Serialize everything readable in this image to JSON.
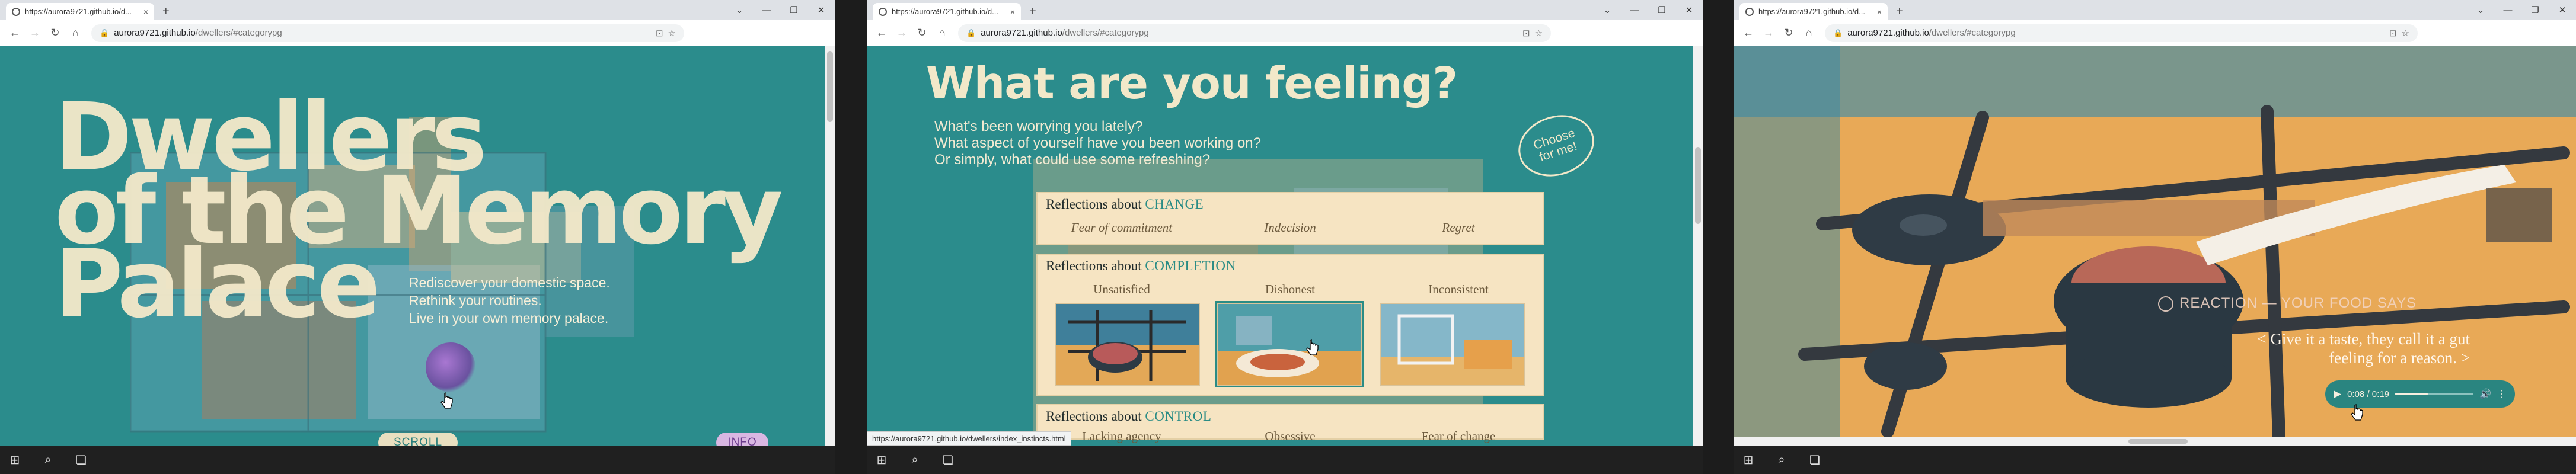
{
  "colors": {
    "teal": "#2b8c8c",
    "cream": "#f2e8c9",
    "lavender": "#d9b7e2",
    "accent_keyword": "#2a8c85"
  },
  "screens": [
    {
      "tab": {
        "title": "https://aurora9721.github.io/d...",
        "close": "×"
      },
      "new_tab": "+",
      "window_controls": {
        "tabs_menu": "⌄",
        "minimize": "—",
        "restore": "❐",
        "close": "✕"
      },
      "address": {
        "host": "aurora9721.github.io",
        "path": "/dwellers/#categorypg"
      },
      "hero": {
        "line1": "Dwellers",
        "line2": "of the Memory",
        "line3": "Palace"
      },
      "tagline": {
        "line1": "Rediscover your domestic space.",
        "line2": "Rethink your routines.",
        "line3": "Live in your own memory palace."
      },
      "scroll_label": "SCROLL",
      "info_label": "INFO"
    },
    {
      "tab": {
        "title": "https://aurora9721.github.io/d...",
        "close": "×"
      },
      "new_tab": "+",
      "window_controls": {
        "tabs_menu": "⌄",
        "minimize": "—",
        "restore": "❐",
        "close": "✕"
      },
      "address": {
        "host": "aurora9721.github.io",
        "path": "/dwellers/#categorypg"
      },
      "heading": "What are you feeling?",
      "questions": {
        "q1": "What's been worrying you lately?",
        "q2": "What aspect of yourself have you been working on?",
        "q3": "Or simply, what could use some refreshing?"
      },
      "stamp": {
        "line1": "Choose",
        "line2": "for me!"
      },
      "categories": [
        {
          "prefix": "Reflections about ",
          "keyword": "CHANGE",
          "items": [
            "Fear of commitment",
            "Indecision",
            "Regret"
          ]
        },
        {
          "prefix": "Reflections about ",
          "keyword": "COMPLETION",
          "items": [
            "Unsatisfied",
            "Dishonest",
            "Inconsistent"
          ]
        },
        {
          "prefix": "Reflections about ",
          "keyword": "CONTROL",
          "items": [
            "Lacking agency",
            "Obsessive",
            "Fear of change"
          ]
        }
      ],
      "status_link": "https://aurora9721.github.io/dwellers/index_instincts.html"
    },
    {
      "tab": {
        "title": "https://aurora9721.github.io/d...",
        "close": "×"
      },
      "new_tab": "+",
      "window_controls": {
        "tabs_menu": "⌄",
        "minimize": "—",
        "restore": "❐",
        "close": "✕"
      },
      "address": {
        "host": "aurora9721.github.io",
        "path": "/dwellers/#categorypg"
      },
      "reaction": "REACTION — YOUR FOOD SAYS",
      "quote": {
        "line1": "< Give it a taste, they call it a gut",
        "line2": "feeling for a reason. >"
      },
      "audio": {
        "time": "0:08 / 0:19",
        "progress": 0.42
      }
    }
  ],
  "icons": {
    "back": "←",
    "forward": "→",
    "reload": "↻",
    "home": "⌂",
    "lock": "🔒",
    "install": "⊡",
    "star": "☆",
    "windows": "⊞",
    "search": "⌕",
    "taskview": "❏",
    "play": "▶",
    "volume": "🔊",
    "more": "⋮"
  }
}
